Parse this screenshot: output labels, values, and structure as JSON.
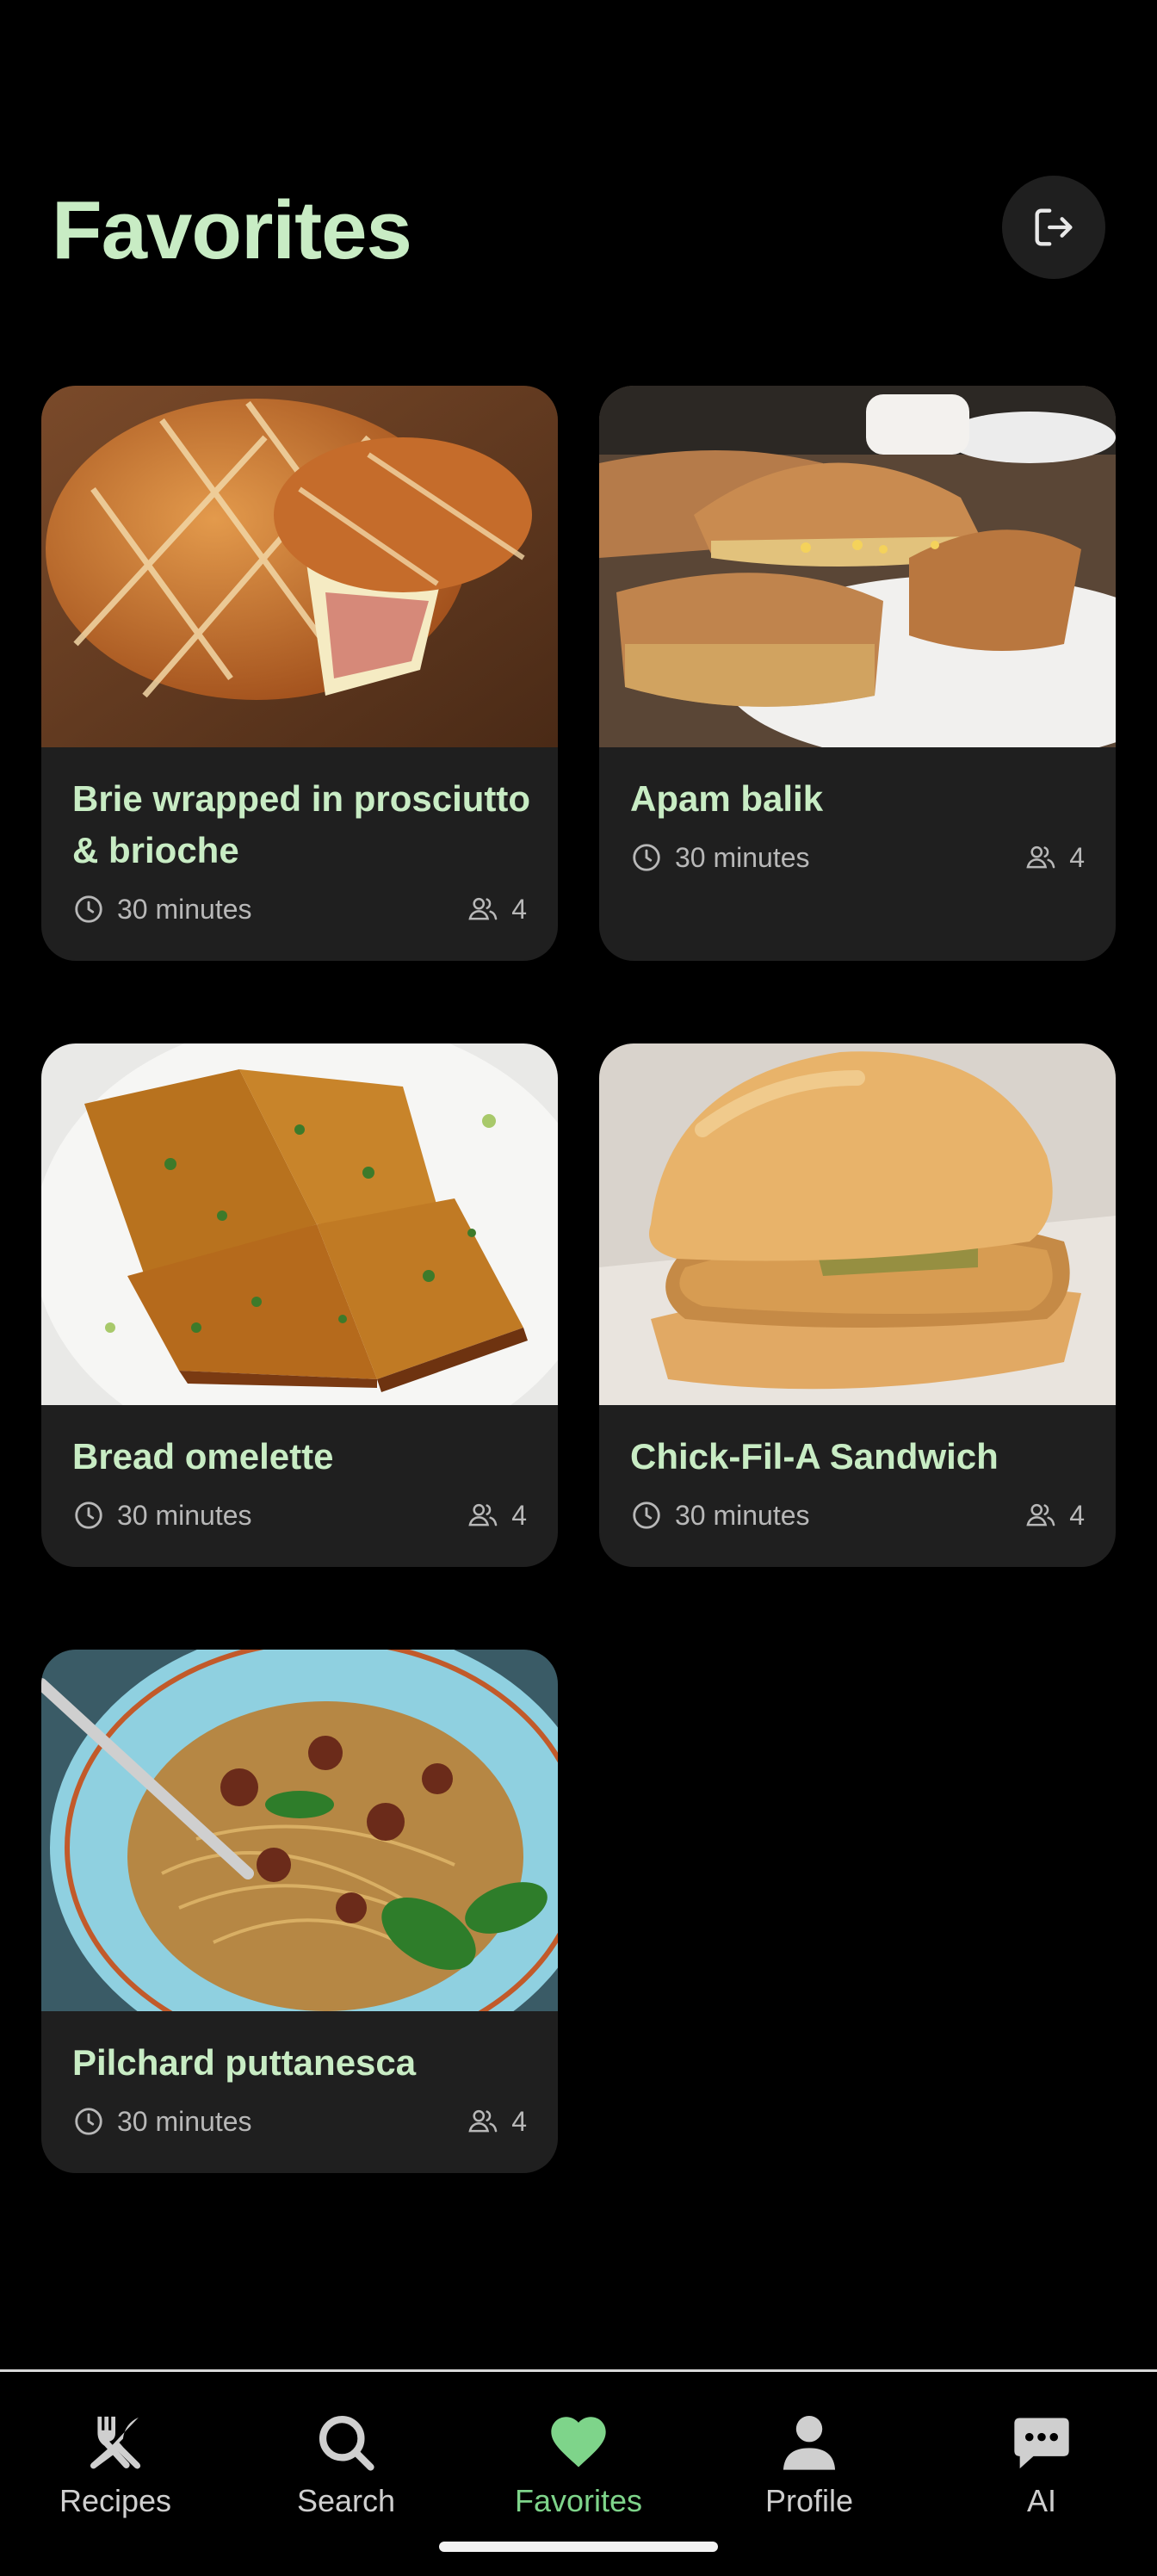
{
  "page": {
    "title": "Favorites",
    "logout_icon": "logout-icon"
  },
  "colors": {
    "background": "#000000",
    "card": "#1f1f1f",
    "title_green": "#c8ecc4",
    "active_green": "#7ed48a",
    "meta_gray": "#b8b8b8"
  },
  "recipes": [
    {
      "name": "Brie wrapped in prosciutto & brioche",
      "time": "30 minutes",
      "servings": "4"
    },
    {
      "name": "Apam balik",
      "time": "30 minutes",
      "servings": "4"
    },
    {
      "name": "Bread omelette",
      "time": "30 minutes",
      "servings": "4"
    },
    {
      "name": "Chick-Fil-A Sandwich",
      "time": "30 minutes",
      "servings": "4"
    },
    {
      "name": "Pilchard puttanesca",
      "time": "30 minutes",
      "servings": "4"
    }
  ],
  "nav": {
    "items": [
      {
        "label": "Recipes",
        "icon": "fork-knife-icon",
        "active": false
      },
      {
        "label": "Search",
        "icon": "search-icon",
        "active": false
      },
      {
        "label": "Favorites",
        "icon": "heart-icon",
        "active": true
      },
      {
        "label": "Profile",
        "icon": "person-icon",
        "active": false
      },
      {
        "label": "AI",
        "icon": "chat-icon",
        "active": false
      }
    ]
  }
}
